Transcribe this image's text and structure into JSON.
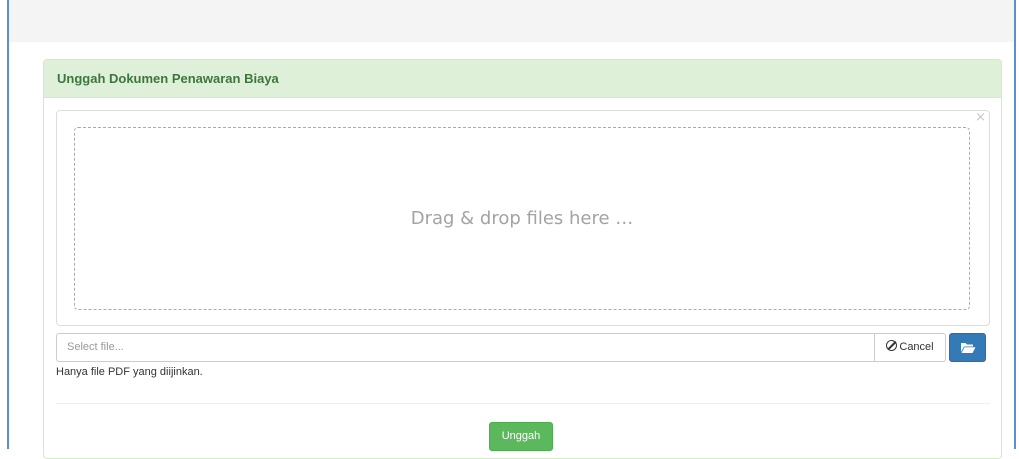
{
  "panel": {
    "title": "Unggah Dokumen Penawaran Biaya"
  },
  "preview": {
    "close_symbol": "×",
    "dropzone_text": "Drag & drop files here …"
  },
  "file_input": {
    "placeholder": "Select file...",
    "cancel_label": "Cancel",
    "cancel_icon": "ban-icon",
    "browse_icon": "folder-open-icon"
  },
  "help_text": "Hanya file PDF yang diijinkan.",
  "submit_label": "Unggah",
  "colors": {
    "panel_heading_bg": "#dff0d8",
    "panel_heading_text": "#3c763d",
    "browse_button": "#337ab7",
    "submit_button": "#5cb85c"
  }
}
